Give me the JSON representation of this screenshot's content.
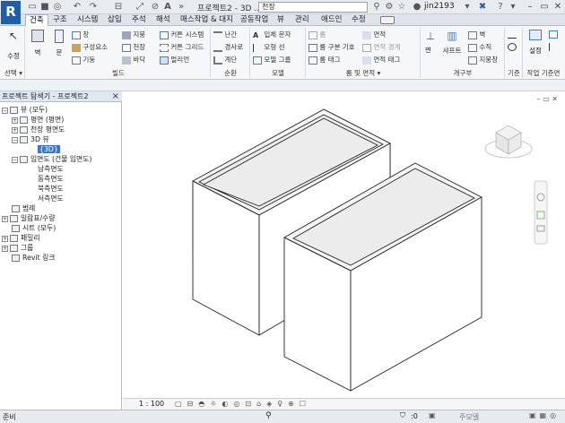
{
  "app": {
    "logo": "R",
    "doc_title": "프로젝트2 - 3D ...",
    "search_value": "천장",
    "user": "jin2193"
  },
  "tabs": [
    "건축",
    "구조",
    "시스템",
    "삽입",
    "주석",
    "해석",
    "매스작업 & 대지",
    "공동작업",
    "뷰",
    "관리",
    "애드인",
    "수정"
  ],
  "ribbon": {
    "modify": "수정",
    "wall": "벽",
    "door": "문",
    "col1": [
      "창",
      "구성요소",
      "기둥"
    ],
    "col2": [
      "지붕",
      "천장",
      "바닥"
    ],
    "col3": [
      "커튼 시스템",
      "커튼 그리드",
      "멀리언"
    ],
    "col4": [
      "난간",
      "경사로",
      "계단"
    ],
    "col5": [
      "입체 문자",
      "모형 선",
      "모델 그룹"
    ],
    "col6": [
      "룸",
      "룸 구분 기호",
      "룸 태그"
    ],
    "col7": [
      "면적",
      "면적 경계",
      "면적 태그"
    ],
    "col8": [
      "면",
      "샤프트"
    ],
    "col9": [
      "벽",
      "수직",
      "지붕창"
    ],
    "level": "레벨",
    "grid": "그리드",
    "set": "설정",
    "groups": [
      "선택",
      "빌드",
      "순환",
      "모델",
      "룸 및 면적",
      "개구부",
      "기준",
      "작업 기준면"
    ]
  },
  "browser": {
    "title": "프로젝트 탐색기 - 프로젝트2",
    "close": "×",
    "tree": [
      {
        "label": "뷰 (모두)",
        "level": 0,
        "tw": "−"
      },
      {
        "label": "평면 (평면)",
        "level": 1,
        "tw": "+"
      },
      {
        "label": "천장 평면도",
        "level": 1,
        "tw": "+"
      },
      {
        "label": "3D 뷰",
        "level": 1,
        "tw": "−"
      },
      {
        "label": "{3D}",
        "level": 2,
        "tw": "",
        "selected": true
      },
      {
        "label": "입면도 (건물 입면도)",
        "level": 1,
        "tw": "−"
      },
      {
        "label": "남측면도",
        "level": 2,
        "tw": ""
      },
      {
        "label": "동측면도",
        "level": 2,
        "tw": ""
      },
      {
        "label": "북측면도",
        "level": 2,
        "tw": ""
      },
      {
        "label": "서측면도",
        "level": 2,
        "tw": ""
      },
      {
        "label": "범례",
        "level": 0,
        "tw": ""
      },
      {
        "label": "일람표/수량",
        "level": 0,
        "tw": "+"
      },
      {
        "label": "시트 (모두)",
        "level": 0,
        "tw": ""
      },
      {
        "label": "패밀리",
        "level": 0,
        "tw": "+"
      },
      {
        "label": "그룹",
        "level": 0,
        "tw": "+"
      },
      {
        "label": "Revit 링크",
        "level": 0,
        "tw": ""
      }
    ]
  },
  "viewbar": {
    "scale": "1 : 100"
  },
  "status": {
    "left": "준비",
    "count": ":0",
    "model": "주모델"
  },
  "colors": {
    "accent": "#3875d6",
    "logo": "#1f5fa9"
  }
}
